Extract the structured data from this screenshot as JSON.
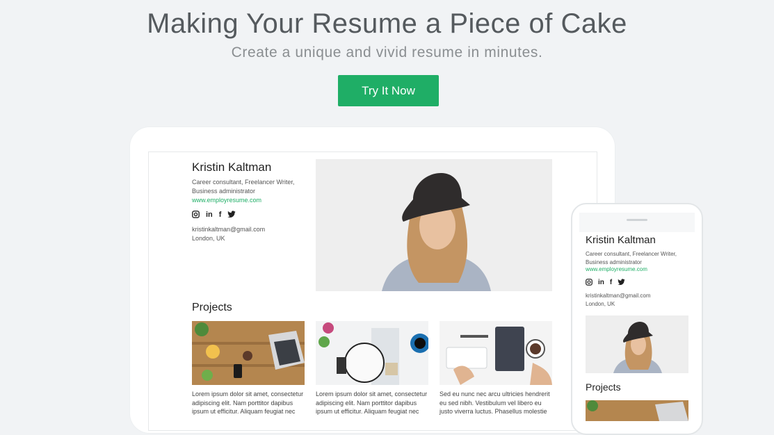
{
  "hero": {
    "title": "Making Your Resume a Piece of Cake",
    "subtitle": "Create a unique and vivid resume in minutes.",
    "cta_label": "Try It Now"
  },
  "resume": {
    "name": "Kristin Kaltman",
    "role": "Career consultant, Freelancer Writer, Business administrator",
    "website": "www.employresume.com",
    "social": [
      "instagram-icon",
      "linkedin-icon",
      "facebook-icon",
      "twitter-icon"
    ],
    "social_labels": {
      "linkedin": "in",
      "facebook": "f"
    },
    "email": "kristinkaltman@gmail.com",
    "location": "London, UK",
    "projects_heading": "Projects",
    "projects": [
      {
        "text": "Lorem ipsum dolor sit amet, consectetur adipiscing elit. Nam porttitor dapibus ipsum ut efficitur. Aliquam feugiat nec"
      },
      {
        "text": "Lorem ipsum dolor sit amet, consectetur adipiscing elit. Nam porttitor dapibus ipsum ut efficitur. Aliquam feugiat nec"
      },
      {
        "text": "Sed eu nunc nec arcu ultricies hendrerit eu sed nibh. Vestibulum vel libero eu justo viverra luctus. Phasellus molestie"
      }
    ]
  },
  "colors": {
    "accent": "#1fae66",
    "background": "#f1f3f5"
  }
}
